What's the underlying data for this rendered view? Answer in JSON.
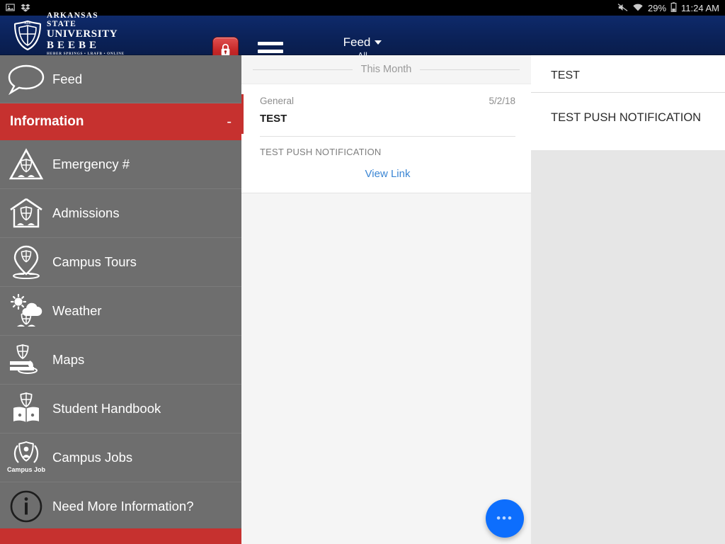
{
  "statusbar": {
    "left_icons": [
      "image-icon",
      "dropbox-icon"
    ],
    "mute_icon": "mute-icon",
    "wifi_icon": "wifi-icon",
    "battery_percent": "29%",
    "battery_icon": "battery-icon",
    "time": "11:24 AM"
  },
  "appbar": {
    "logo": {
      "line1": "ARKANSAS STATE",
      "line2": "UNIVERSITY",
      "line3": "BEEBE",
      "line4": "HEBER SPRINGS • LRAFB • ONLINE • SEARCY",
      "crest_icon": "asu-crest-icon"
    },
    "lock_button_icon": "lock-icon",
    "menu_button_icon": "hamburger-menu-icon",
    "title": "Feed",
    "title_caret_icon": "chevron-down-icon",
    "subtitle": "All",
    "background_color": "#0b2259"
  },
  "sidebar": {
    "background_color": "#6e6e6e",
    "accent_color": "#c6312f",
    "feed": {
      "label": "Feed",
      "icon": "speech-bubble-icon"
    },
    "section": {
      "title": "Information",
      "toggle": "-"
    },
    "items": [
      {
        "label": "Emergency #",
        "icon": "warning-triangle-crest-icon"
      },
      {
        "label": "Admissions",
        "icon": "house-crest-icon"
      },
      {
        "label": "Campus Tours",
        "icon": "map-pin-crest-icon"
      },
      {
        "label": "Weather",
        "icon": "sun-cloud-crest-icon"
      },
      {
        "label": "Maps",
        "icon": "map-crest-icon"
      },
      {
        "label": "Student Handbook",
        "icon": "open-book-crest-icon"
      },
      {
        "label": "Campus Jobs",
        "icon": "campus-job-badge-icon"
      },
      {
        "label": "Need More Information?",
        "icon": "info-circle-icon"
      }
    ],
    "next_section_partial": ""
  },
  "feed": {
    "separator_label": "This Month",
    "card": {
      "category": "General",
      "date": "5/2/18",
      "title": "TEST",
      "body": "TEST PUSH NOTIFICATION",
      "link_label": "View Link",
      "stripe_color": "#c6312f"
    },
    "fab": {
      "label": "•••",
      "icon": "more-options-icon",
      "color": "#0d6efd"
    }
  },
  "detail": {
    "title": "TEST",
    "body": "TEST PUSH NOTIFICATION",
    "background_color": "#e6e6e6"
  }
}
